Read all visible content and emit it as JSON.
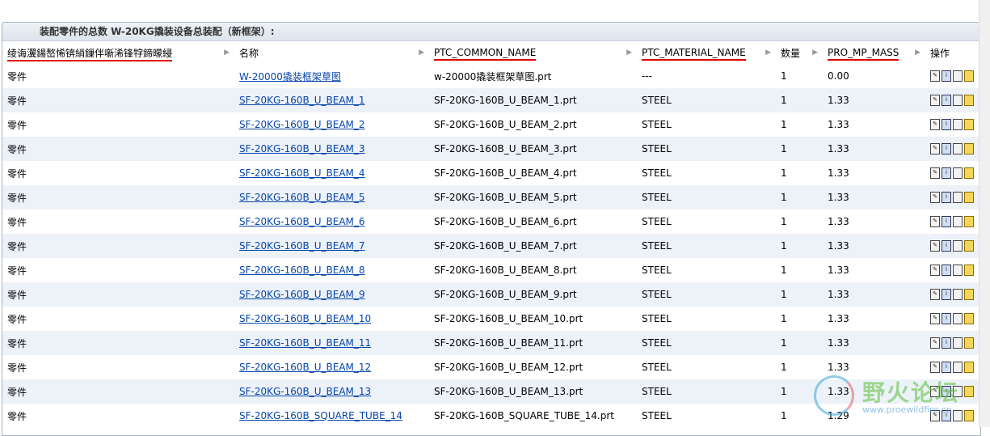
{
  "title": "装配零件的总数 W-20KG撬装设备总装配（新框架）:",
  "headers": {
    "col1": "绫诲瀷鍚嶅悕锛綃鏁伴噺浠锋牸鍗曚綅",
    "col2": "名称",
    "col3": "PTC_COMMON_NAME",
    "col4": "PTC_MATERIAL_NAME",
    "col5": "数量",
    "col6": "PRO_MP_MASS",
    "col7": "操作"
  },
  "rows": [
    {
      "type": "零件",
      "name": "W-20000撬装框架草图",
      "common": "w-20000撬装框架草图.prt",
      "material": "---",
      "qty": "1",
      "mass": "0.00"
    },
    {
      "type": "零件",
      "name": "SF-20KG-160B_U_BEAM_1",
      "common": "SF-20KG-160B_U_BEAM_1.prt",
      "material": "STEEL",
      "qty": "1",
      "mass": "1.33"
    },
    {
      "type": "零件",
      "name": "SF-20KG-160B_U_BEAM_2",
      "common": "SF-20KG-160B_U_BEAM_2.prt",
      "material": "STEEL",
      "qty": "1",
      "mass": "1.33"
    },
    {
      "type": "零件",
      "name": "SF-20KG-160B_U_BEAM_3",
      "common": "SF-20KG-160B_U_BEAM_3.prt",
      "material": "STEEL",
      "qty": "1",
      "mass": "1.33"
    },
    {
      "type": "零件",
      "name": "SF-20KG-160B_U_BEAM_4",
      "common": "SF-20KG-160B_U_BEAM_4.prt",
      "material": "STEEL",
      "qty": "1",
      "mass": "1.33"
    },
    {
      "type": "零件",
      "name": "SF-20KG-160B_U_BEAM_5",
      "common": "SF-20KG-160B_U_BEAM_5.prt",
      "material": "STEEL",
      "qty": "1",
      "mass": "1.33"
    },
    {
      "type": "零件",
      "name": "SF-20KG-160B_U_BEAM_6",
      "common": "SF-20KG-160B_U_BEAM_6.prt",
      "material": "STEEL",
      "qty": "1",
      "mass": "1.33"
    },
    {
      "type": "零件",
      "name": "SF-20KG-160B_U_BEAM_7",
      "common": "SF-20KG-160B_U_BEAM_7.prt",
      "material": "STEEL",
      "qty": "1",
      "mass": "1.33"
    },
    {
      "type": "零件",
      "name": "SF-20KG-160B_U_BEAM_8",
      "common": "SF-20KG-160B_U_BEAM_8.prt",
      "material": "STEEL",
      "qty": "1",
      "mass": "1.33"
    },
    {
      "type": "零件",
      "name": "SF-20KG-160B_U_BEAM_9",
      "common": "SF-20KG-160B_U_BEAM_9.prt",
      "material": "STEEL",
      "qty": "1",
      "mass": "1.33"
    },
    {
      "type": "零件",
      "name": "SF-20KG-160B_U_BEAM_10",
      "common": "SF-20KG-160B_U_BEAM_10.prt",
      "material": "STEEL",
      "qty": "1",
      "mass": "1.33"
    },
    {
      "type": "零件",
      "name": "SF-20KG-160B_U_BEAM_11",
      "common": "SF-20KG-160B_U_BEAM_11.prt",
      "material": "STEEL",
      "qty": "1",
      "mass": "1.33"
    },
    {
      "type": "零件",
      "name": "SF-20KG-160B_U_BEAM_12",
      "common": "SF-20KG-160B_U_BEAM_12.prt",
      "material": "STEEL",
      "qty": "1",
      "mass": "1.33"
    },
    {
      "type": "零件",
      "name": "SF-20KG-160B_U_BEAM_13",
      "common": "SF-20KG-160B_U_BEAM_13.prt",
      "material": "STEEL",
      "qty": "1",
      "mass": "1.33"
    },
    {
      "type": "零件",
      "name": "SF-20KG-160B_SQUARE_TUBE_14",
      "common": "SF-20KG-160B_SQUARE_TUBE_14.prt",
      "material": "STEEL",
      "qty": "1",
      "mass": "1.29"
    }
  ],
  "watermark": {
    "text": "野火论坛",
    "url": "www.proewildfire.cn"
  },
  "colors": {
    "link": "#0645ad",
    "row_alt": "#edf2f8",
    "annotation_red": "#e00000"
  }
}
